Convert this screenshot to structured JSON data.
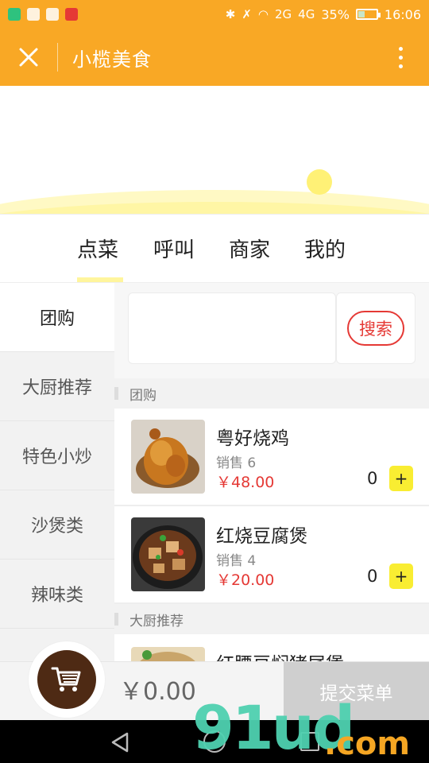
{
  "status_bar": {
    "signal_label": "2G",
    "network_label": "4G",
    "battery_percent": "35%",
    "battery_level": 0.35,
    "time": "16:06"
  },
  "title_bar": {
    "title": "小榄美食",
    "close_icon": "close-icon",
    "more_icon": "more-vertical-icon"
  },
  "tabs": [
    {
      "label": "点菜",
      "active": true
    },
    {
      "label": "呼叫",
      "active": false
    },
    {
      "label": "商家",
      "active": false
    },
    {
      "label": "我的",
      "active": false
    }
  ],
  "sidebar": {
    "items": [
      {
        "label": "团购",
        "active": true
      },
      {
        "label": "大厨推荐",
        "active": false
      },
      {
        "label": "特色小炒",
        "active": false
      },
      {
        "label": "沙煲类",
        "active": false
      },
      {
        "label": "辣味类",
        "active": false
      }
    ]
  },
  "search": {
    "value": "",
    "placeholder": "",
    "button_label": "搜索"
  },
  "sections": [
    {
      "title": "团购",
      "dishes": [
        {
          "name": "粤好烧鸡",
          "sales": "销售 6",
          "price": "￥48.00",
          "qty": "0",
          "add_label": "+"
        },
        {
          "name": "红烧豆腐煲",
          "sales": "销售 4",
          "price": "￥20.00",
          "qty": "0",
          "add_label": "+"
        }
      ]
    },
    {
      "title": "大厨推荐",
      "dishes": [
        {
          "name": "红腰豆焖猪尾煲"
        }
      ]
    }
  ],
  "cart": {
    "total": "￥0.00",
    "submit_label": "提交菜单",
    "cart_icon": "cart-icon"
  },
  "watermark": {
    "main": "91ud",
    "suffix": ".com"
  },
  "colors": {
    "brand": "#f9a825",
    "accent_yellow": "#f9ed32",
    "price_red": "#e53935",
    "cart_brown": "#4e2a14"
  }
}
